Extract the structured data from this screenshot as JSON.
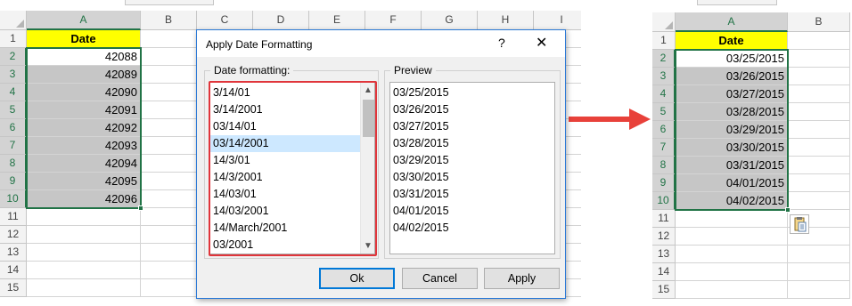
{
  "left_sheet": {
    "columns": [
      "A",
      "B",
      "C",
      "D",
      "E",
      "F",
      "G",
      "H",
      "I"
    ],
    "rows": [
      "1",
      "2",
      "3",
      "4",
      "5",
      "6",
      "7",
      "8",
      "9",
      "10",
      "11",
      "12",
      "13",
      "14",
      "15"
    ],
    "header": "Date",
    "values": [
      "42088",
      "42089",
      "42090",
      "42091",
      "42092",
      "42093",
      "42094",
      "42095",
      "42096"
    ]
  },
  "right_sheet": {
    "columns": [
      "A",
      "B"
    ],
    "rows": [
      "1",
      "2",
      "3",
      "4",
      "5",
      "6",
      "7",
      "8",
      "9",
      "10",
      "11",
      "12",
      "13",
      "14",
      "15"
    ],
    "header": "Date",
    "values": [
      "03/25/2015",
      "03/26/2015",
      "03/27/2015",
      "03/28/2015",
      "03/29/2015",
      "03/30/2015",
      "03/31/2015",
      "04/01/2015",
      "04/02/2015"
    ]
  },
  "dialog": {
    "title": "Apply Date Formatting",
    "help": "?",
    "close": "✕",
    "formatting_label": "Date formatting:",
    "preview_label": "Preview",
    "formats": [
      "3/14/01",
      "3/14/2001",
      "03/14/01",
      "03/14/2001",
      "14/3/01",
      "14/3/2001",
      "14/03/01",
      "14/03/2001",
      "14/March/2001",
      "03/2001"
    ],
    "selected_format_index": 3,
    "preview": [
      "03/25/2015",
      "03/26/2015",
      "03/27/2015",
      "03/28/2015",
      "03/29/2015",
      "03/30/2015",
      "03/31/2015",
      "04/01/2015",
      "04/02/2015"
    ],
    "buttons": {
      "ok": "Ok",
      "cancel": "Cancel",
      "apply": "Apply"
    },
    "scroll_up": "▲",
    "scroll_down": "▼"
  },
  "colors": {
    "header_fill": "#ffff00",
    "selection": "#217346",
    "highlight_box": "#e0353b",
    "arrow": "#e8413a"
  },
  "icons": [
    "arrow-right-icon",
    "paste-options-icon",
    "help-icon",
    "close-icon"
  ]
}
